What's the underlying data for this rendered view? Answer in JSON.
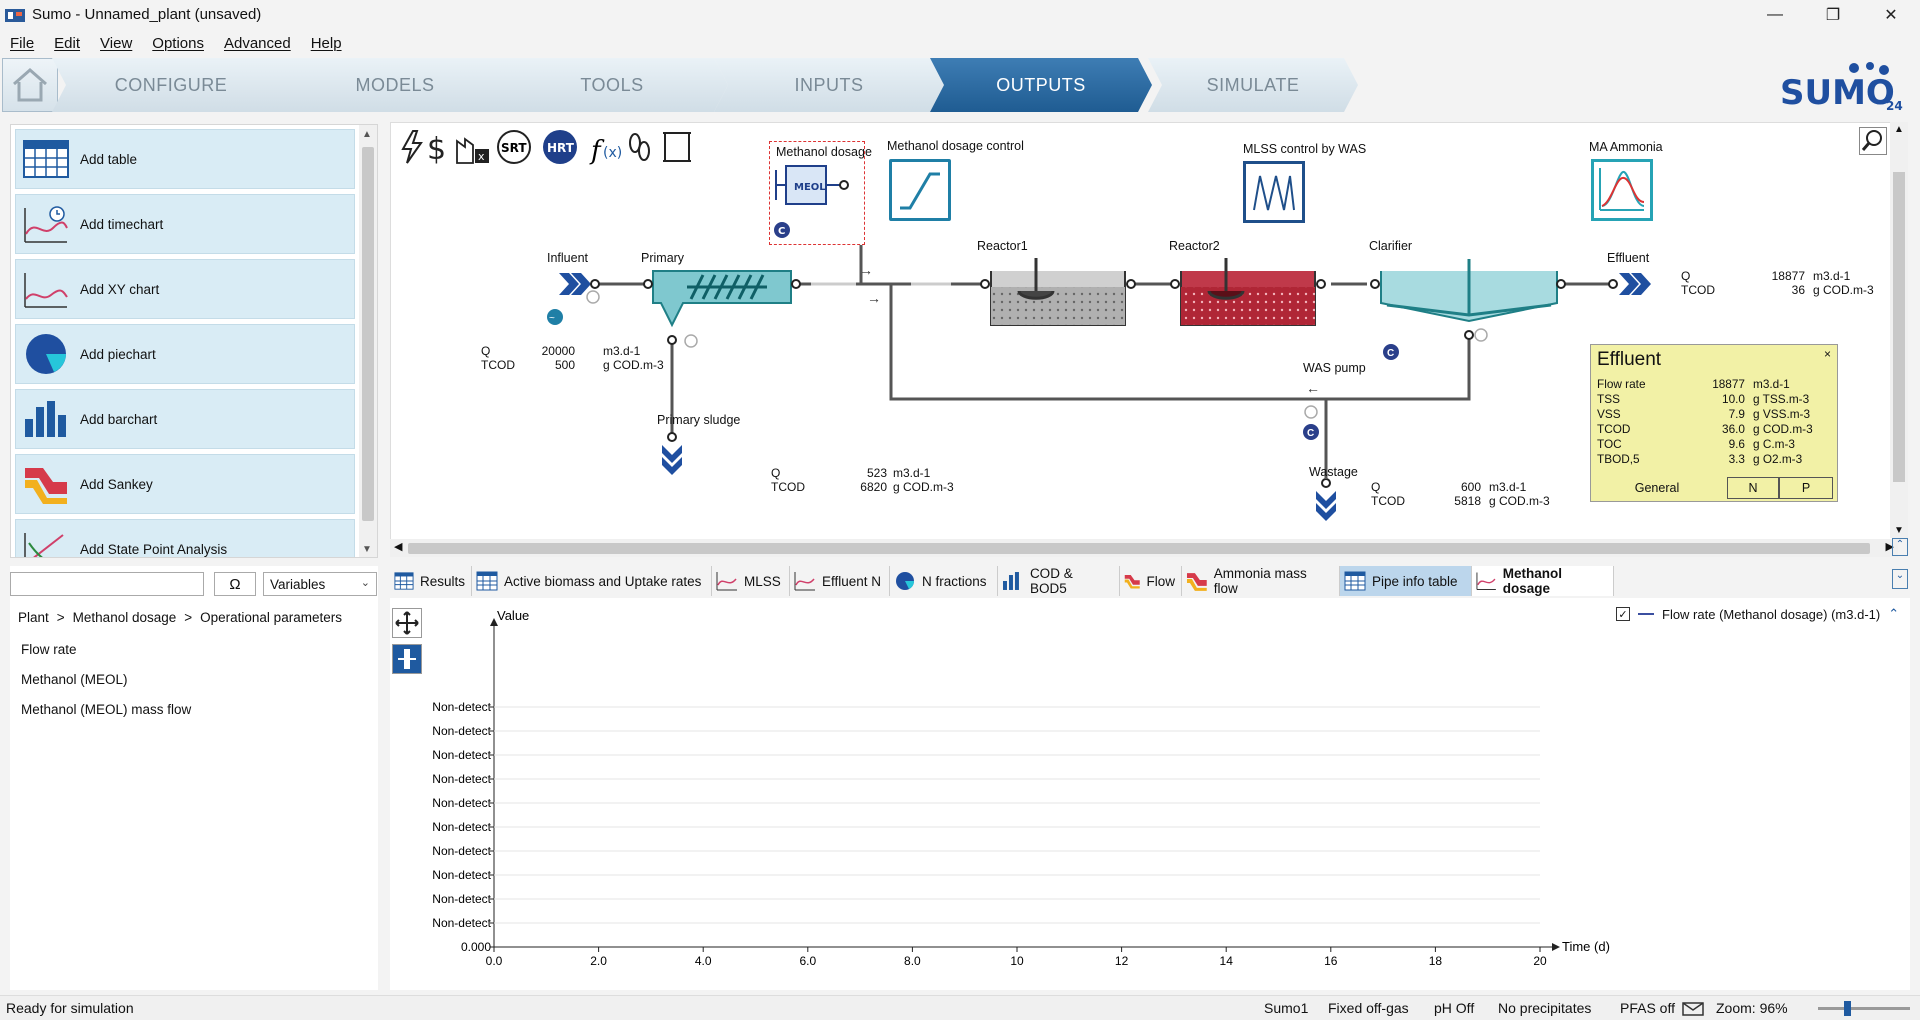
{
  "window": {
    "title": "Sumo - Unnamed_plant (unsaved)"
  },
  "menu": [
    "File",
    "Edit",
    "View",
    "Options",
    "Advanced",
    "Help"
  ],
  "ribbon": {
    "tabs": [
      "CONFIGURE",
      "MODELS",
      "TOOLS",
      "INPUTS",
      "OUTPUTS",
      "SIMULATE"
    ],
    "active": "OUTPUTS"
  },
  "logo": {
    "text": "SUMO",
    "version": "24"
  },
  "add_panel": [
    "Add table",
    "Add timechart",
    "Add XY chart",
    "Add piechart",
    "Add barchart",
    "Add Sankey",
    "Add State Point Analysis"
  ],
  "var_browser": {
    "search_placeholder": "",
    "omega": "Ω",
    "dropdown": "Variables",
    "breadcrumb": [
      "Plant",
      ">",
      "Methanol dosage",
      ">",
      "Operational parameters"
    ],
    "items": [
      "Flow rate",
      "Methanol (MEOL)",
      "Methanol (MEOL) mass flow"
    ]
  },
  "diagram": {
    "toolbar_icons": [
      "power-icon",
      "cost-icon",
      "emissions-icon",
      "srt-icon",
      "hrt-icon",
      "function-icon",
      "footprint-icon",
      "scroll-icon"
    ],
    "srt": "SRT",
    "hrt": "HRT",
    "controllers": [
      "Methanol dosage control",
      "MLSS control by WAS",
      "MA Ammonia"
    ],
    "units": {
      "methanol_dosage": "Methanol dosage",
      "meol": "MEOL",
      "influent": "Influent",
      "primary": "Primary",
      "reactor1": "Reactor1",
      "reactor2": "Reactor2",
      "clarifier": "Clarifier",
      "effluent": "Effluent",
      "primary_sludge": "Primary sludge",
      "was_pump": "WAS pump",
      "wastage": "Wastage"
    },
    "labels": {
      "influent": {
        "q_label": "Q",
        "q": "20000",
        "q_unit": "m3.d-1",
        "tcod_label": "TCOD",
        "tcod": "500",
        "tcod_unit": "g COD.m-3"
      },
      "effluent": {
        "q_label": "Q",
        "q": "18877",
        "q_unit": "m3.d-1",
        "tcod_label": "TCOD",
        "tcod": "36",
        "tcod_unit": "g COD.m-3"
      },
      "primary_sludge": {
        "q_label": "Q",
        "q": "523",
        "q_unit": "m3.d-1",
        "tcod_label": "TCOD",
        "tcod": "6820",
        "tcod_unit": "g COD.m-3"
      },
      "wastage": {
        "q_label": "Q",
        "q": "600",
        "q_unit": "m3.d-1",
        "tcod_label": "TCOD",
        "tcod": "5818",
        "tcod_unit": "g COD.m-3"
      }
    },
    "effluent_popup": {
      "title": "Effluent",
      "close": "×",
      "rows": [
        {
          "name": "Flow rate",
          "value": "18877",
          "unit": "m3.d-1"
        },
        {
          "name": "TSS",
          "value": "10.0",
          "unit": "g TSS.m-3"
        },
        {
          "name": "VSS",
          "value": "7.9",
          "unit": "g VSS.m-3"
        },
        {
          "name": "TCOD",
          "value": "36.0",
          "unit": "g COD.m-3"
        },
        {
          "name": "TOC",
          "value": "9.6",
          "unit": "g C.m-3"
        },
        {
          "name": "TBOD,5",
          "value": "3.3",
          "unit": "g O2.m-3"
        }
      ],
      "tabs": [
        "General",
        "N",
        "P"
      ]
    }
  },
  "output_tabs": [
    {
      "label": "Results",
      "icon": "table-icon"
    },
    {
      "label": "Active biomass and Uptake rates",
      "icon": "table-icon"
    },
    {
      "label": "MLSS",
      "icon": "timechart-icon"
    },
    {
      "label": "Effluent N",
      "icon": "timechart-icon"
    },
    {
      "label": "N fractions",
      "icon": "piechart-icon"
    },
    {
      "label": "COD & BOD5",
      "icon": "barchart-icon"
    },
    {
      "label": "Flow",
      "icon": "sankey-icon"
    },
    {
      "label": "Ammonia mass flow",
      "icon": "sankey-icon"
    },
    {
      "label": "Pipe info table",
      "icon": "table-icon"
    },
    {
      "label": "Methanol dosage",
      "icon": "timechart-icon"
    }
  ],
  "chart_data": {
    "type": "line",
    "title": "",
    "ylabel": "Value",
    "xlabel": "Time  (d)",
    "x_ticks": [
      "0.0",
      "2.0",
      "4.0",
      "6.0",
      "8.0",
      "10",
      "12",
      "14",
      "16",
      "18",
      "20"
    ],
    "y_ticks": [
      "0.000",
      "Non-detect",
      "Non-detect",
      "Non-detect",
      "Non-detect",
      "Non-detect",
      "Non-detect",
      "Non-detect",
      "Non-detect",
      "Non-detect",
      "Non-detect"
    ],
    "xlim": [
      0,
      20
    ],
    "series": [
      {
        "name": "Flow rate (Methanol dosage) (m3.d-1)",
        "x": [],
        "y": [],
        "color": "#3b4fa0"
      }
    ],
    "legend": "top-right",
    "legend_checked": true,
    "grid": true
  },
  "status": {
    "message": "Ready for simulation",
    "items": [
      "Sumo1",
      "Fixed off-gas",
      "pH Off",
      "No precipitates",
      "PFAS off",
      "Zoom: 96%"
    ]
  }
}
